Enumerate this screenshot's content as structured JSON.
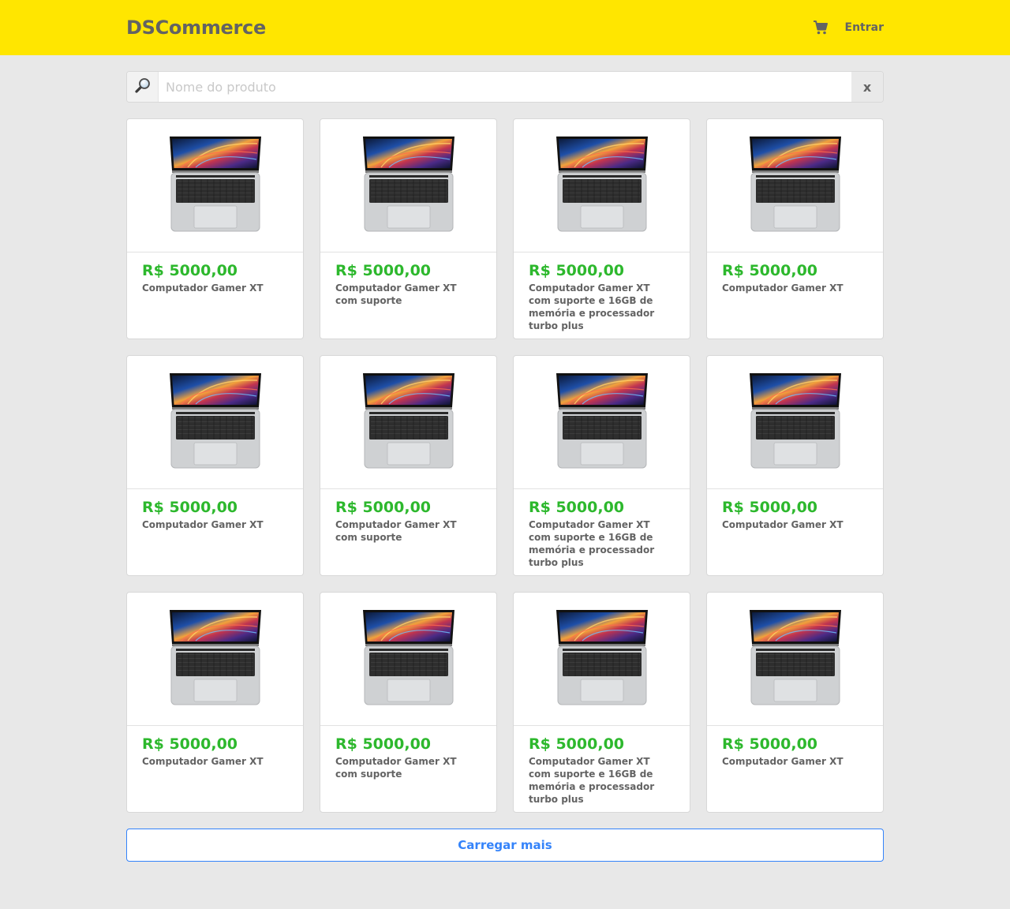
{
  "header": {
    "brand": "DSCommerce",
    "cart_icon": "shopping-cart-icon",
    "login_label": "Entrar"
  },
  "search": {
    "icon": "magnifying-glass-icon",
    "placeholder": "Nome do produto",
    "value": "",
    "clear_label": "x"
  },
  "products": [
    {
      "price": "R$ 5000,00",
      "name": "Computador Gamer XT",
      "image": "laptop-image"
    },
    {
      "price": "R$ 5000,00",
      "name": "Computador Gamer XT com suporte",
      "image": "laptop-image"
    },
    {
      "price": "R$ 5000,00",
      "name": "Computador Gamer XT com suporte e 16GB de memória e processador turbo plus",
      "image": "laptop-image"
    },
    {
      "price": "R$ 5000,00",
      "name": "Computador Gamer XT",
      "image": "laptop-image"
    },
    {
      "price": "R$ 5000,00",
      "name": "Computador Gamer XT",
      "image": "laptop-image"
    },
    {
      "price": "R$ 5000,00",
      "name": "Computador Gamer XT com suporte",
      "image": "laptop-image"
    },
    {
      "price": "R$ 5000,00",
      "name": "Computador Gamer XT com suporte e 16GB de memória e processador turbo plus",
      "image": "laptop-image"
    },
    {
      "price": "R$ 5000,00",
      "name": "Computador Gamer XT",
      "image": "laptop-image"
    },
    {
      "price": "R$ 5000,00",
      "name": "Computador Gamer XT",
      "image": "laptop-image"
    },
    {
      "price": "R$ 5000,00",
      "name": "Computador Gamer XT com suporte",
      "image": "laptop-image"
    },
    {
      "price": "R$ 5000,00",
      "name": "Computador Gamer XT com suporte e 16GB de memória e processador turbo plus",
      "image": "laptop-image"
    },
    {
      "price": "R$ 5000,00",
      "name": "Computador Gamer XT",
      "image": "laptop-image"
    }
  ],
  "load_more_label": "Carregar mais",
  "colors": {
    "header_bg": "#ffe600",
    "page_bg": "#e8e8e8",
    "price": "#2db82d",
    "text": "#636363",
    "accent": "#3483fa"
  }
}
